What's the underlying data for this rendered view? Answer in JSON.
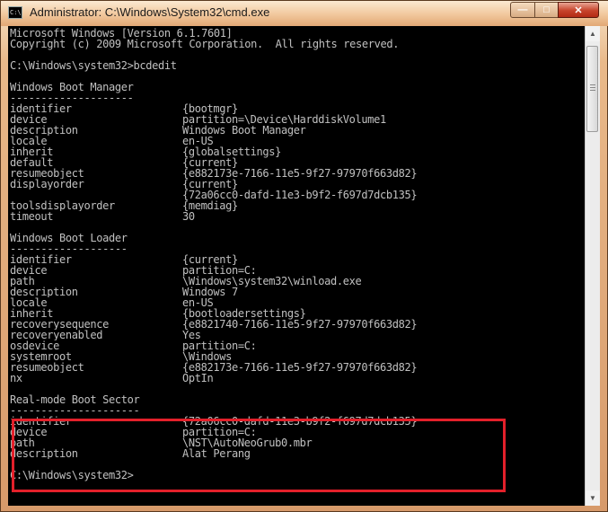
{
  "window": {
    "title": "Administrator: C:\\Windows\\System32\\cmd.exe",
    "app_icon_text": "C:\\",
    "minimize_glyph": "—",
    "maximize_glyph": "□",
    "close_glyph": "✕"
  },
  "console": {
    "header": [
      "Microsoft Windows [Version 6.1.7601]",
      "Copyright (c) 2009 Microsoft Corporation.  All rights reserved.",
      "",
      "C:\\Windows\\system32>bcdedit",
      ""
    ],
    "sections": [
      {
        "title": "Windows Boot Manager",
        "underline": "--------------------",
        "entries": [
          {
            "key": "identifier",
            "value": "{bootmgr}"
          },
          {
            "key": "device",
            "value": "partition=\\Device\\HarddiskVolume1"
          },
          {
            "key": "description",
            "value": "Windows Boot Manager"
          },
          {
            "key": "locale",
            "value": "en-US"
          },
          {
            "key": "inherit",
            "value": "{globalsettings}"
          },
          {
            "key": "default",
            "value": "{current}"
          },
          {
            "key": "resumeobject",
            "value": "{e882173e-7166-11e5-9f27-97970f663d82}"
          },
          {
            "key": "displayorder",
            "value": "{current}"
          },
          {
            "key": "",
            "value": "{72a06cc0-dafd-11e3-b9f2-f697d7dcb135}"
          },
          {
            "key": "toolsdisplayorder",
            "value": "{memdiag}"
          },
          {
            "key": "timeout",
            "value": "30"
          }
        ]
      },
      {
        "title": "Windows Boot Loader",
        "underline": "-------------------",
        "entries": [
          {
            "key": "identifier",
            "value": "{current}"
          },
          {
            "key": "device",
            "value": "partition=C:"
          },
          {
            "key": "path",
            "value": "\\Windows\\system32\\winload.exe"
          },
          {
            "key": "description",
            "value": "Windows 7"
          },
          {
            "key": "locale",
            "value": "en-US"
          },
          {
            "key": "inherit",
            "value": "{bootloadersettings}"
          },
          {
            "key": "recoverysequence",
            "value": "{e8821740-7166-11e5-9f27-97970f663d82}"
          },
          {
            "key": "recoveryenabled",
            "value": "Yes"
          },
          {
            "key": "osdevice",
            "value": "partition=C:"
          },
          {
            "key": "systemroot",
            "value": "\\Windows"
          },
          {
            "key": "resumeobject",
            "value": "{e882173e-7166-11e5-9f27-97970f663d82}"
          },
          {
            "key": "nx",
            "value": "OptIn"
          }
        ]
      },
      {
        "title": "Real-mode Boot Sector",
        "underline": "---------------------",
        "entries": [
          {
            "key": "identifier",
            "value": "{72a06cc0-dafd-11e3-b9f2-f697d7dcb135}"
          },
          {
            "key": "device",
            "value": "partition=C:"
          },
          {
            "key": "path",
            "value": "\\NST\\AutoNeoGrub0.mbr"
          },
          {
            "key": "description",
            "value": "Alat Perang"
          }
        ]
      }
    ],
    "prompt": "C:\\Windows\\system32>",
    "highlight_color": "#e3202a"
  },
  "scrollbar": {
    "up_glyph": "▲",
    "down_glyph": "▼"
  }
}
